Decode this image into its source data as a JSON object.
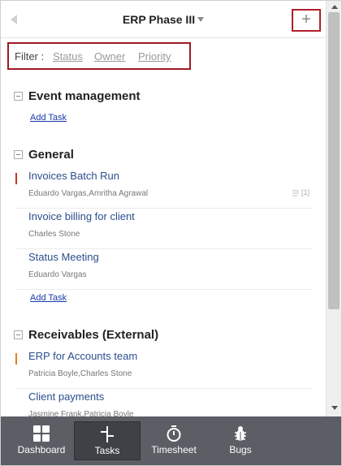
{
  "header": {
    "title": "ERP Phase III",
    "add_label": "+"
  },
  "filter": {
    "label": "Filter :",
    "options": [
      "Status",
      "Owner",
      "Priority"
    ]
  },
  "sections": [
    {
      "title": "Event management",
      "add_task_label": "Add Task",
      "tasks": []
    },
    {
      "title": "General",
      "add_task_label": "Add Task",
      "tasks": [
        {
          "name": "Invoices Batch Run",
          "assignees": "Eduardo Vargas,Amritha Agrawal",
          "meta": "[1]",
          "marker_color": "#c0392b"
        },
        {
          "name": "Invoice billing for client",
          "assignees": "Charles Stone",
          "meta": "",
          "marker_color": ""
        },
        {
          "name": "Status Meeting",
          "assignees": "Eduardo Vargas",
          "meta": "",
          "marker_color": ""
        }
      ]
    },
    {
      "title": "Receivables (External)",
      "add_task_label": "",
      "tasks": [
        {
          "name": "ERP for Accounts team",
          "assignees": "Patricia Boyle,Charles Stone",
          "meta": "",
          "marker_color": "#e67e22"
        },
        {
          "name": "Client payments",
          "assignees": "Jasmine Frank,Patricia Boyle",
          "meta": "",
          "marker_color": ""
        }
      ]
    }
  ],
  "nav": {
    "items": [
      {
        "label": "Dashboard",
        "icon": "grid-icon",
        "active": false
      },
      {
        "label": "Tasks",
        "icon": "tasks-icon",
        "active": true
      },
      {
        "label": "Timesheet",
        "icon": "stopwatch-icon",
        "active": false
      },
      {
        "label": "Bugs",
        "icon": "bug-icon",
        "active": false
      }
    ]
  },
  "colors": {
    "highlight_border": "#b01e2a",
    "task_link": "#2a4e8c",
    "add_task_link": "#1a3aa8",
    "nav_bg": "#5b5e64",
    "nav_active_bg": "#3e4146"
  }
}
